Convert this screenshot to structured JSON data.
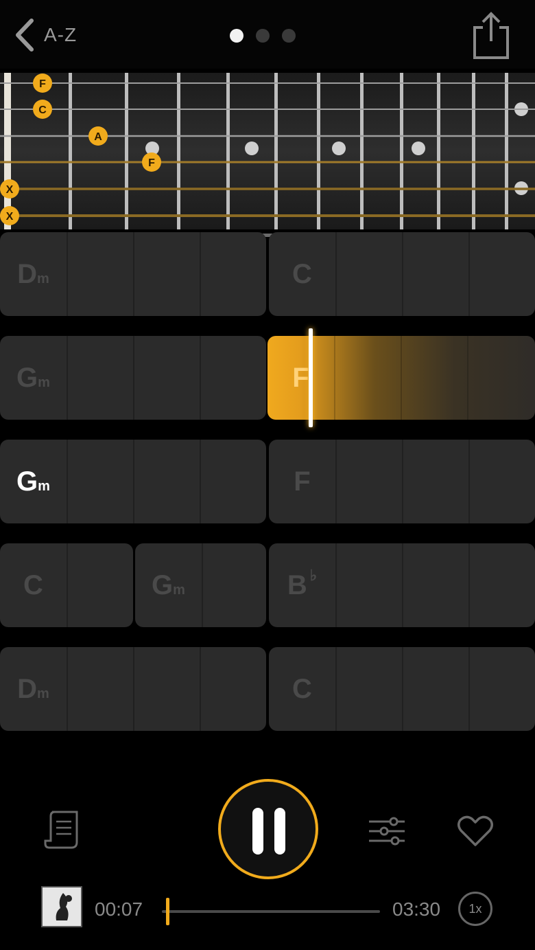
{
  "nav": {
    "back_label": "A-Z"
  },
  "pager": {
    "count": 3,
    "active_index": 0
  },
  "fretboard": {
    "markers": [
      {
        "label": "F"
      },
      {
        "label": "C"
      },
      {
        "label": "A"
      },
      {
        "label": "F"
      },
      {
        "label": "X"
      },
      {
        "label": "X"
      }
    ]
  },
  "chords": {
    "row1": [
      {
        "root": "D",
        "quality": "m"
      },
      {
        "root": "C",
        "quality": ""
      }
    ],
    "row2": [
      {
        "root": "G",
        "quality": "m"
      },
      {
        "root": "F",
        "quality": ""
      }
    ],
    "row3": [
      {
        "root": "G",
        "quality": "m"
      },
      {
        "root": "F",
        "quality": ""
      }
    ],
    "row4": [
      {
        "root": "C",
        "quality": ""
      },
      {
        "root": "G",
        "quality": "m"
      },
      {
        "root": "B",
        "quality": "",
        "accidental": "♭"
      }
    ],
    "row5": [
      {
        "root": "D",
        "quality": "m"
      },
      {
        "root": "C",
        "quality": ""
      }
    ]
  },
  "player": {
    "elapsed": "00:07",
    "duration": "03:30",
    "speed": "1x",
    "progress_fraction": 0.033
  },
  "colors": {
    "accent": "#f1ab1c",
    "background": "#000000",
    "block": "#2b2b2b"
  }
}
